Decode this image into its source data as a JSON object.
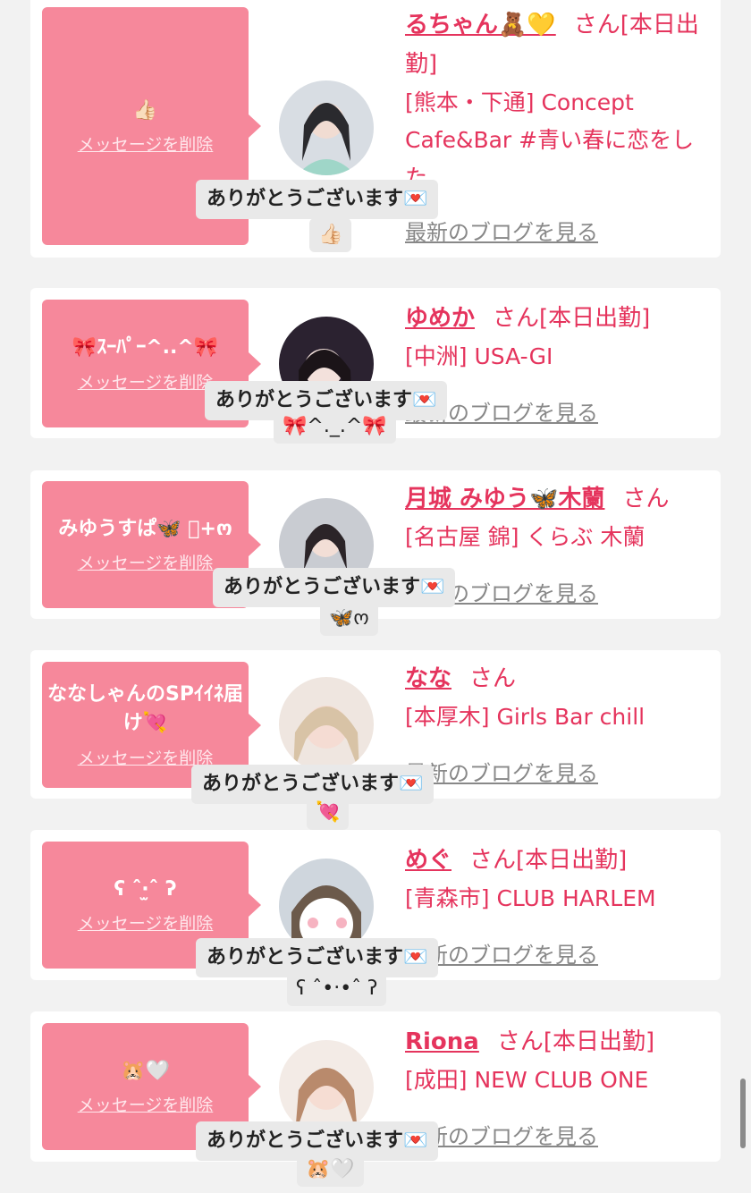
{
  "delete_label": "メッセージを削除",
  "blog_label": "最新のブログを見る",
  "reply_label": "ありがとうございます💌",
  "cards": [
    {
      "message": "👍🏻",
      "name": "るちゃん🧸💛",
      "suffix": "さん[本日出勤]",
      "shop": "[熊本・下通] Concept Cafe&Bar #青い春に恋をした",
      "reply_emoji": "👍🏻"
    },
    {
      "message": "🎀ｽｰﾊﾟｰ^..^🎀",
      "name": "ゆめか",
      "suffix": "さん[本日出勤]",
      "shop": "[中洲] USA-GI",
      "reply_emoji": "🎀^._.^🎀"
    },
    {
      "message": "みゆうすぱ🦋 ﾟ+ო",
      "name": "月城 みゆう🦋木蘭",
      "suffix": "さん",
      "shop": "[名古屋 錦] くらぶ 木蘭",
      "reply_emoji": "🦋ო"
    },
    {
      "message": "ななしゃんのSPｲｲﾈ届け💘",
      "name": "なな",
      "suffix": "さん",
      "shop": "[本厚木] Girls Bar chill",
      "reply_emoji": "💘"
    },
    {
      "message": "ʕ ˆ‧̫ˆ ʔ",
      "name": "めぐ",
      "suffix": "さん[本日出勤]",
      "shop": "[青森市] CLUB HARLEM",
      "reply_emoji": "ʕ ˆ•‧•ˆ ʔ"
    },
    {
      "message": "🐹🤍",
      "name": "Riona",
      "suffix": "さん[本日出勤]",
      "shop": "[成田] NEW CLUB ONE",
      "reply_emoji": "🐹🤍"
    }
  ],
  "colors": {
    "bubble": "#f6889b",
    "accent": "#e5345d",
    "link_gray": "#888888",
    "background": "#f2f2f2"
  }
}
